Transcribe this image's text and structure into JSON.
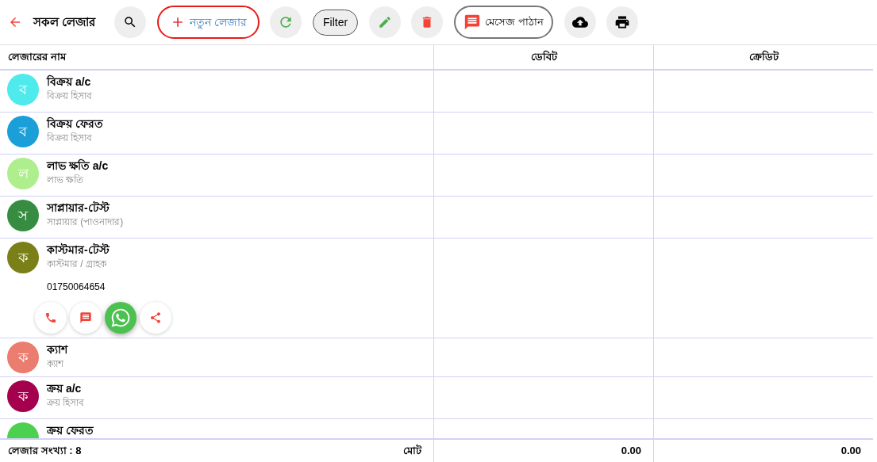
{
  "toolbar": {
    "title": "সকল লেজার",
    "new_button": "নতুন লেজার",
    "filter_button": "Filter",
    "message_button": "মেসেজ পাঠান"
  },
  "table": {
    "columns": [
      "লেজারের নাম",
      "ডেবিট",
      "ক্রেডিট"
    ],
    "rows": [
      {
        "letter": "ব",
        "color": "#4eeaec",
        "name": "বিক্রয় a/c",
        "group": "বিক্রয় হিসাব",
        "expanded": false
      },
      {
        "letter": "ব",
        "color": "#1a9fd9",
        "name": "বিক্রয় ফেরত",
        "group": "বিক্রয় হিসাব",
        "expanded": false
      },
      {
        "letter": "ল",
        "color": "#aeee8c",
        "name": "লাভ ক্ষতি a/c",
        "group": "লাভ ক্ষতি",
        "expanded": false
      },
      {
        "letter": "স",
        "color": "#368d42",
        "name": "সাপ্লায়ার-টেস্ট",
        "group": "সাপ্লায়ার (পাওনাদার)",
        "expanded": false
      },
      {
        "letter": "ক",
        "color": "#7a7f17",
        "name": "কাস্টমার-টেস্ট",
        "group": "কাস্টমার / গ্রাহক",
        "phone": "01750064654",
        "expanded": true
      },
      {
        "letter": "ক",
        "color": "#eb7c70",
        "name": "ক্যাশ",
        "group": "ক্যাশ",
        "expanded": false
      },
      {
        "letter": "ক",
        "color": "#a5004e",
        "name": "ক্রয় a/c",
        "group": "ক্রয় হিসাব",
        "expanded": false
      },
      {
        "color": "#4cd04f",
        "name": "ক্রয় ফেরত",
        "expanded": false
      }
    ],
    "footer": {
      "count": "লেজার সংখ্যা : 8",
      "total_label": "মোট",
      "debit_total": "0.00",
      "credit_total": "0.00"
    }
  }
}
